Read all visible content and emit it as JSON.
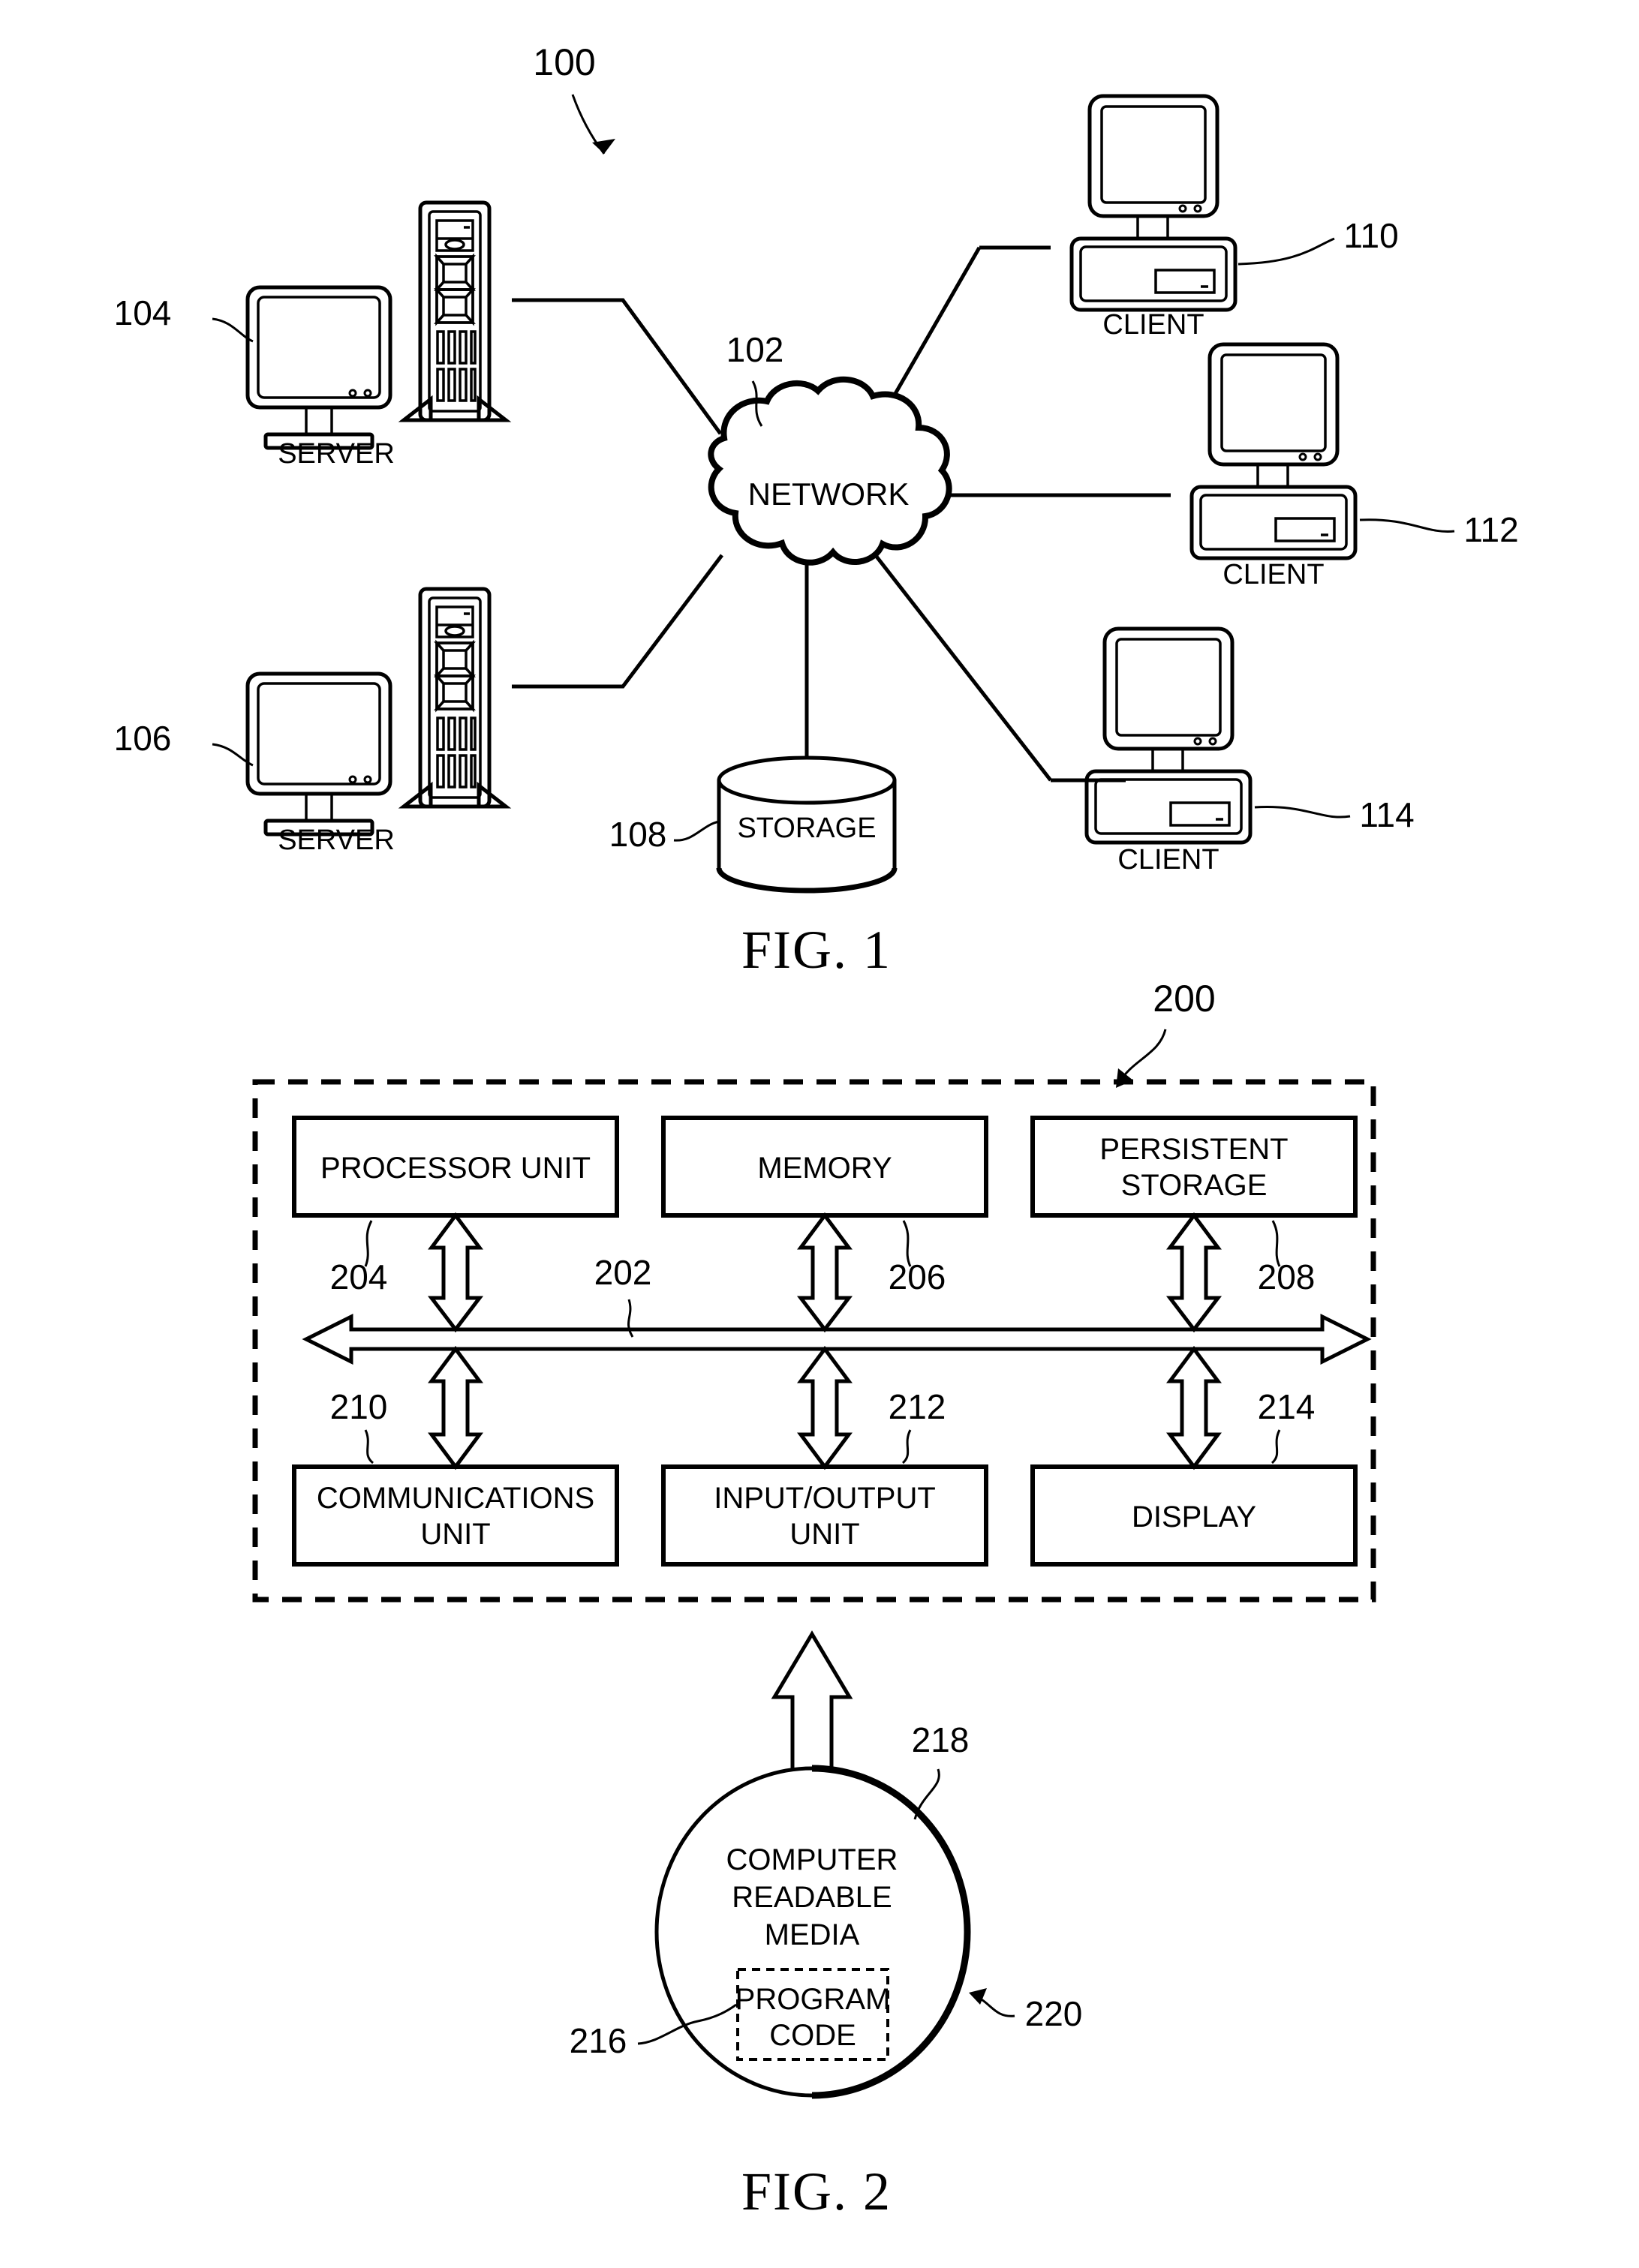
{
  "figure1": {
    "caption": "FIG. 1",
    "ref_system": "100",
    "nodes": {
      "server_top": {
        "label": "SERVER",
        "ref": "104"
      },
      "server_bottom": {
        "label": "SERVER",
        "ref": "106"
      },
      "network": {
        "label": "NETWORK",
        "ref": "102"
      },
      "storage": {
        "label": "STORAGE",
        "ref": "108"
      },
      "client_top": {
        "label": "CLIENT",
        "ref": "110"
      },
      "client_mid": {
        "label": "CLIENT",
        "ref": "112"
      },
      "client_bottom": {
        "label": "CLIENT",
        "ref": "114"
      }
    }
  },
  "figure2": {
    "caption": "FIG. 2",
    "ref_system": "200",
    "bus": {
      "ref": "202"
    },
    "top_row": [
      {
        "label": "PROCESSOR UNIT",
        "ref": "204"
      },
      {
        "label": "MEMORY",
        "ref": "206"
      },
      {
        "label_line1": "PERSISTENT",
        "label_line2": "STORAGE",
        "ref": "208"
      }
    ],
    "bottom_row": [
      {
        "label_line1": "COMMUNICATIONS",
        "label_line2": "UNIT",
        "ref": "210"
      },
      {
        "label_line1": "INPUT/OUTPUT",
        "label_line2": "UNIT",
        "ref": "212"
      },
      {
        "label": "DISPLAY",
        "ref": "214"
      }
    ],
    "media": {
      "line1": "COMPUTER",
      "line2": "READABLE",
      "line3": "MEDIA",
      "ref_media": "218",
      "ref_outer": "220",
      "program_code_line1": "PROGRAM",
      "program_code_line2": "CODE",
      "ref_program_code": "216"
    }
  },
  "colors": {
    "ink": "#000000",
    "paper": "#ffffff"
  }
}
